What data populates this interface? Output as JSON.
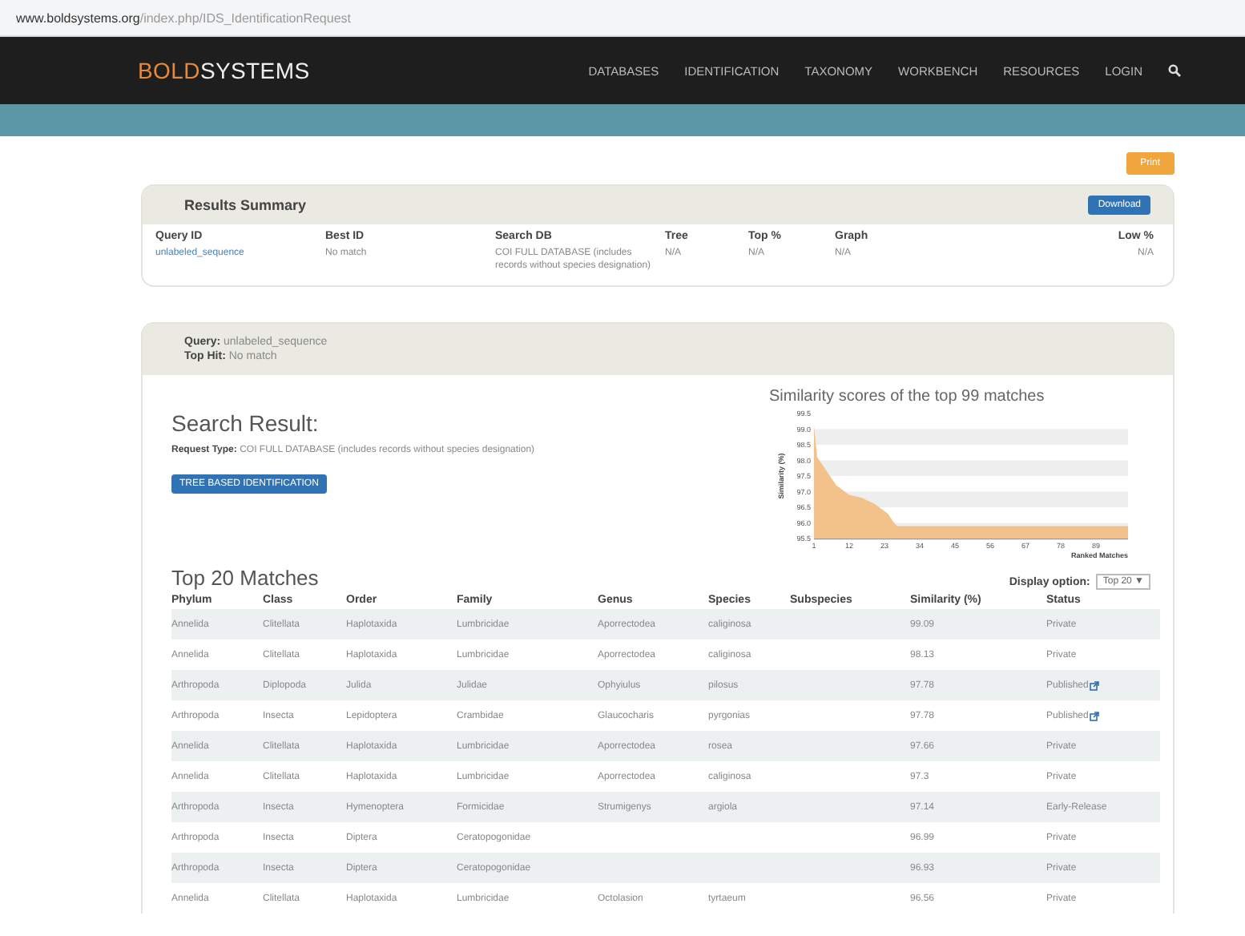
{
  "address_bar": {
    "host": "www.boldsystems.org",
    "path": "/index.php/IDS_IdentificationRequest"
  },
  "nav": {
    "logo_accent": "BOLD",
    "logo_rest": "SYSTEMS",
    "items": [
      "DATABASES",
      "IDENTIFICATION",
      "TAXONOMY",
      "WORKBENCH",
      "RESOURCES",
      "LOGIN"
    ]
  },
  "print_button": "Print",
  "summary": {
    "title": "Results Summary",
    "download_button": "Download",
    "columns": [
      "Query ID",
      "Best ID",
      "Search DB",
      "Tree",
      "Top %",
      "Graph",
      "Low %"
    ],
    "row": [
      "unlabeled_sequence",
      "No match",
      "COI FULL DATABASE (includes records without species designation)",
      "N/A",
      "N/A",
      "N/A",
      "N/A"
    ]
  },
  "query": {
    "query_line": "**Query:** unlabeled_sequence",
    "top_hit_line": "**Top Hit:** No match"
  },
  "search_result": {
    "title": "Search Result:",
    "request_type": "**Request Type:** COI FULL DATABASE (includes records without species designation)",
    "tree_button": "TREE BASED IDENTIFICATION"
  },
  "chart_data": {
    "type": "area",
    "title": "Similarity scores of the top 99 matches",
    "xlabel": "Ranked Matches",
    "ylabel": "Similarity (%)",
    "x": [
      1,
      2,
      4,
      8,
      12,
      16,
      20,
      24,
      26,
      27,
      99
    ],
    "series": [
      {
        "color": "#f2c28a",
        "values": [
          99.1,
          98.1,
          97.8,
          97.2,
          96.9,
          96.8,
          96.6,
          96.3,
          96.0,
          95.9,
          95.9
        ]
      }
    ],
    "xlim": [
      1,
      99
    ],
    "ylim": [
      95.5,
      99.5
    ],
    "xticks": [
      1,
      12,
      23,
      34,
      45,
      56,
      67,
      78,
      89
    ],
    "yticks": [
      {
        "value": 95.5,
        "label": "95.5"
      },
      {
        "value": 96,
        "label": "96.0"
      },
      {
        "value": 96.5,
        "label": "96.5"
      },
      {
        "value": 97,
        "label": "97.0"
      },
      {
        "value": 97.5,
        "label": "97.5"
      },
      {
        "value": 98,
        "label": "98.0"
      },
      {
        "value": 98.5,
        "label": "98.5"
      },
      {
        "value": 99,
        "label": "99.0"
      },
      {
        "value": 99.5,
        "label": "99.5"
      }
    ]
  },
  "matches": {
    "title": "Top 20 Matches",
    "display_label": "Display option:",
    "display_value": "Top 20",
    "display_caret": "▼",
    "columns": [
      "Phylum",
      "Class",
      "Order",
      "Family",
      "Genus",
      "Species",
      "Subspecies",
      "Similarity (%)",
      "Status"
    ],
    "rows": [
      {
        "cells": [
          "Annelida",
          "Clitellata",
          "Haplotaxida",
          "Lumbricidae",
          "Aporrectodea",
          "caliginosa",
          "",
          "99.09"
        ],
        "status": "Private",
        "linked": false
      },
      {
        "cells": [
          "Annelida",
          "Clitellata",
          "Haplotaxida",
          "Lumbricidae",
          "Aporrectodea",
          "caliginosa",
          "",
          "98.13"
        ],
        "status": "Private",
        "linked": false
      },
      {
        "cells": [
          "Arthropoda",
          "Diplopoda",
          "Julida",
          "Julidae",
          "Ophyiulus",
          "pilosus",
          "",
          "97.78"
        ],
        "status": "Published",
        "linked": true
      },
      {
        "cells": [
          "Arthropoda",
          "Insecta",
          "Lepidoptera",
          "Crambidae",
          "Glaucocharis",
          "pyrgonias",
          "",
          "97.78"
        ],
        "status": "Published",
        "linked": true
      },
      {
        "cells": [
          "Annelida",
          "Clitellata",
          "Haplotaxida",
          "Lumbricidae",
          "Aporrectodea",
          "rosea",
          "",
          "97.66"
        ],
        "status": "Private",
        "linked": false
      },
      {
        "cells": [
          "Annelida",
          "Clitellata",
          "Haplotaxida",
          "Lumbricidae",
          "Aporrectodea",
          "caliginosa",
          "",
          "97.3"
        ],
        "status": "Private",
        "linked": false
      },
      {
        "cells": [
          "Arthropoda",
          "Insecta",
          "Hymenoptera",
          "Formicidae",
          "Strumigenys",
          "argiola",
          "",
          "97.14"
        ],
        "status": "Early-Release",
        "linked": false
      },
      {
        "cells": [
          "Arthropoda",
          "Insecta",
          "Diptera",
          "Ceratopogonidae",
          "",
          "",
          "",
          "96.99"
        ],
        "status": "Private",
        "linked": false
      },
      {
        "cells": [
          "Arthropoda",
          "Insecta",
          "Diptera",
          "Ceratopogonidae",
          "",
          "",
          "",
          "96.93"
        ],
        "status": "Private",
        "linked": false
      },
      {
        "cells": [
          "Annelida",
          "Clitellata",
          "Haplotaxida",
          "Lumbricidae",
          "Octolasion",
          "tyrtaeum",
          "",
          "96.56"
        ],
        "status": "Private",
        "linked": false
      }
    ]
  }
}
